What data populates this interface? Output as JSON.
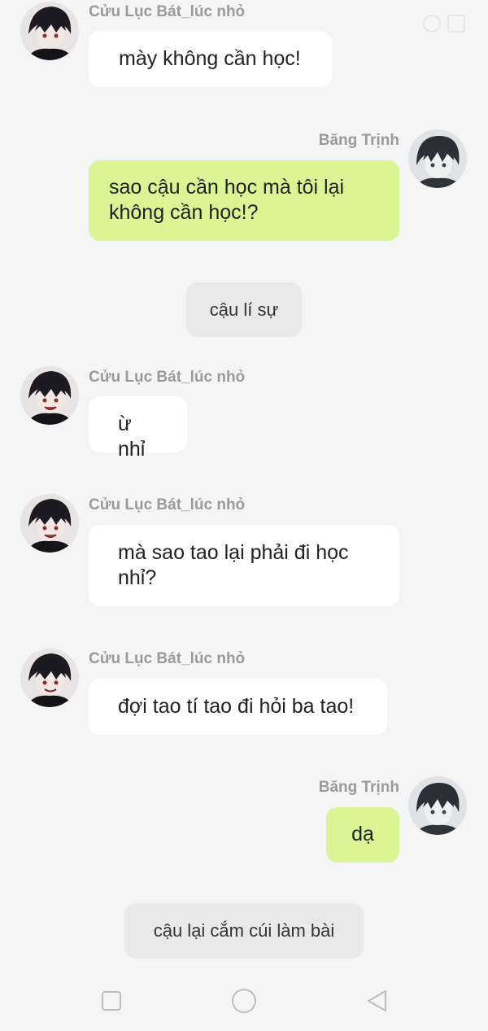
{
  "characters": {
    "left_name": "Cửu Lục Bát_lúc nhỏ",
    "right_name": "Băng Trịnh"
  },
  "messages": [
    {
      "side": "left",
      "name": "Cửu Lục Bát_lúc nhỏ",
      "text": "mày không cần học!"
    },
    {
      "side": "right",
      "name": "Băng Trịnh",
      "text": "sao cậu cần học mà tôi lại không cần học!?"
    },
    {
      "side": "center",
      "text": "cậu lí sự"
    },
    {
      "side": "left",
      "name": "Cửu Lục Bát_lúc nhỏ",
      "text": "ừ nhỉ"
    },
    {
      "side": "left",
      "name": "Cửu Lục Bát_lúc nhỏ",
      "text": "mà sao tao lại phải đi học nhỉ?"
    },
    {
      "side": "left",
      "name": "Cửu Lục Bát_lúc nhỏ",
      "text": "đợi tao tí tao đi hỏi ba tao!"
    },
    {
      "side": "right",
      "name": "Băng Trịnh",
      "text": "dạ"
    },
    {
      "side": "center",
      "text": "cậu lại cắm cúi làm bài"
    }
  ],
  "colors": {
    "right_bubble": "#d9f594",
    "left_bubble": "#ffffff",
    "narration_bubble": "#e9e9e9",
    "background": "#f5f5f5"
  },
  "icons": {
    "nav_left": "square-icon",
    "nav_center": "circle-icon",
    "nav_right": "back-triangle-icon"
  }
}
